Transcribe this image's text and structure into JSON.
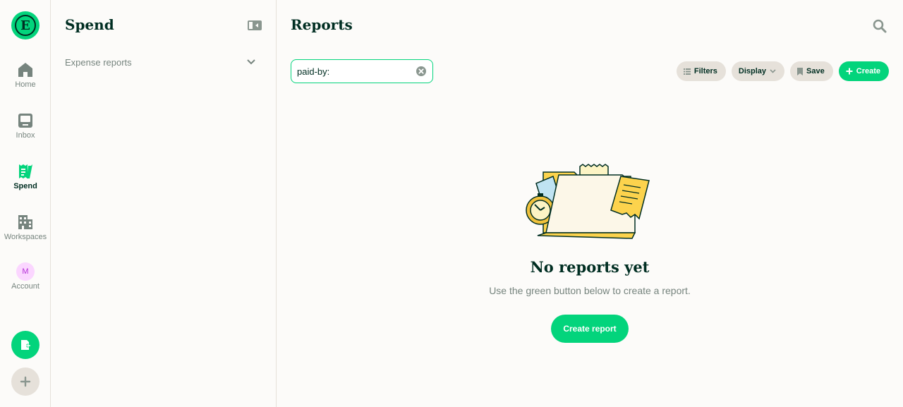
{
  "logo": {
    "letter": "E"
  },
  "nav": {
    "items": [
      {
        "label": "Home",
        "icon": "home-icon"
      },
      {
        "label": "Inbox",
        "icon": "inbox-icon"
      },
      {
        "label": "Spend",
        "icon": "receipt-icon"
      },
      {
        "label": "Workspaces",
        "icon": "building-icon"
      },
      {
        "label": "Account",
        "icon": "avatar"
      }
    ],
    "avatar_initial": "M",
    "active": "Spend"
  },
  "sidebar": {
    "title": "Spend",
    "items": [
      {
        "label": "Expense reports"
      }
    ]
  },
  "main": {
    "title": "Reports",
    "search": {
      "value": "paid-by:",
      "placeholder": ""
    },
    "toolbar": {
      "filters": "Filters",
      "display": "Display",
      "save": "Save",
      "create": "Create"
    },
    "empty_state": {
      "title": "No reports yet",
      "subtitle": "Use the green button below to create a report.",
      "cta": "Create report"
    }
  },
  "colors": {
    "accent": "#03d47c",
    "text": "#002e22",
    "muted": "#76847e",
    "chip": "#e6e1da",
    "background": "#fcfbf9"
  }
}
